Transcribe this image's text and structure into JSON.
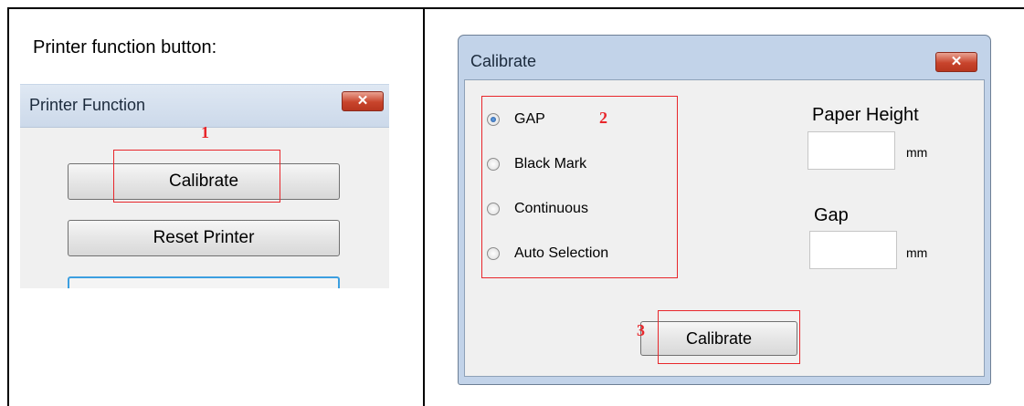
{
  "left": {
    "caption": "Printer function button:",
    "window": {
      "title": "Printer Function",
      "close_symbol": "✕",
      "buttons": {
        "calibrate": "Calibrate",
        "reset": "Reset Printer"
      },
      "marker": "1"
    }
  },
  "right": {
    "dialog": {
      "title": "Calibrate",
      "close_symbol": "✕",
      "media_options": [
        {
          "label": "GAP",
          "checked": true
        },
        {
          "label": "Black Mark",
          "checked": false
        },
        {
          "label": "Continuous",
          "checked": false
        },
        {
          "label": "Auto Selection",
          "checked": false
        }
      ],
      "paper_height_label": "Paper Height",
      "paper_height_value": "",
      "paper_height_unit": "mm",
      "gap_label": "Gap",
      "gap_value": "",
      "gap_unit": "mm",
      "calibrate_button": "Calibrate",
      "markers": {
        "options": "2",
        "button": "3"
      }
    }
  },
  "colors": {
    "highlight": "#e8262b",
    "accent_blue": "#3c9fe0",
    "title_bar": "#c2d3e9"
  }
}
